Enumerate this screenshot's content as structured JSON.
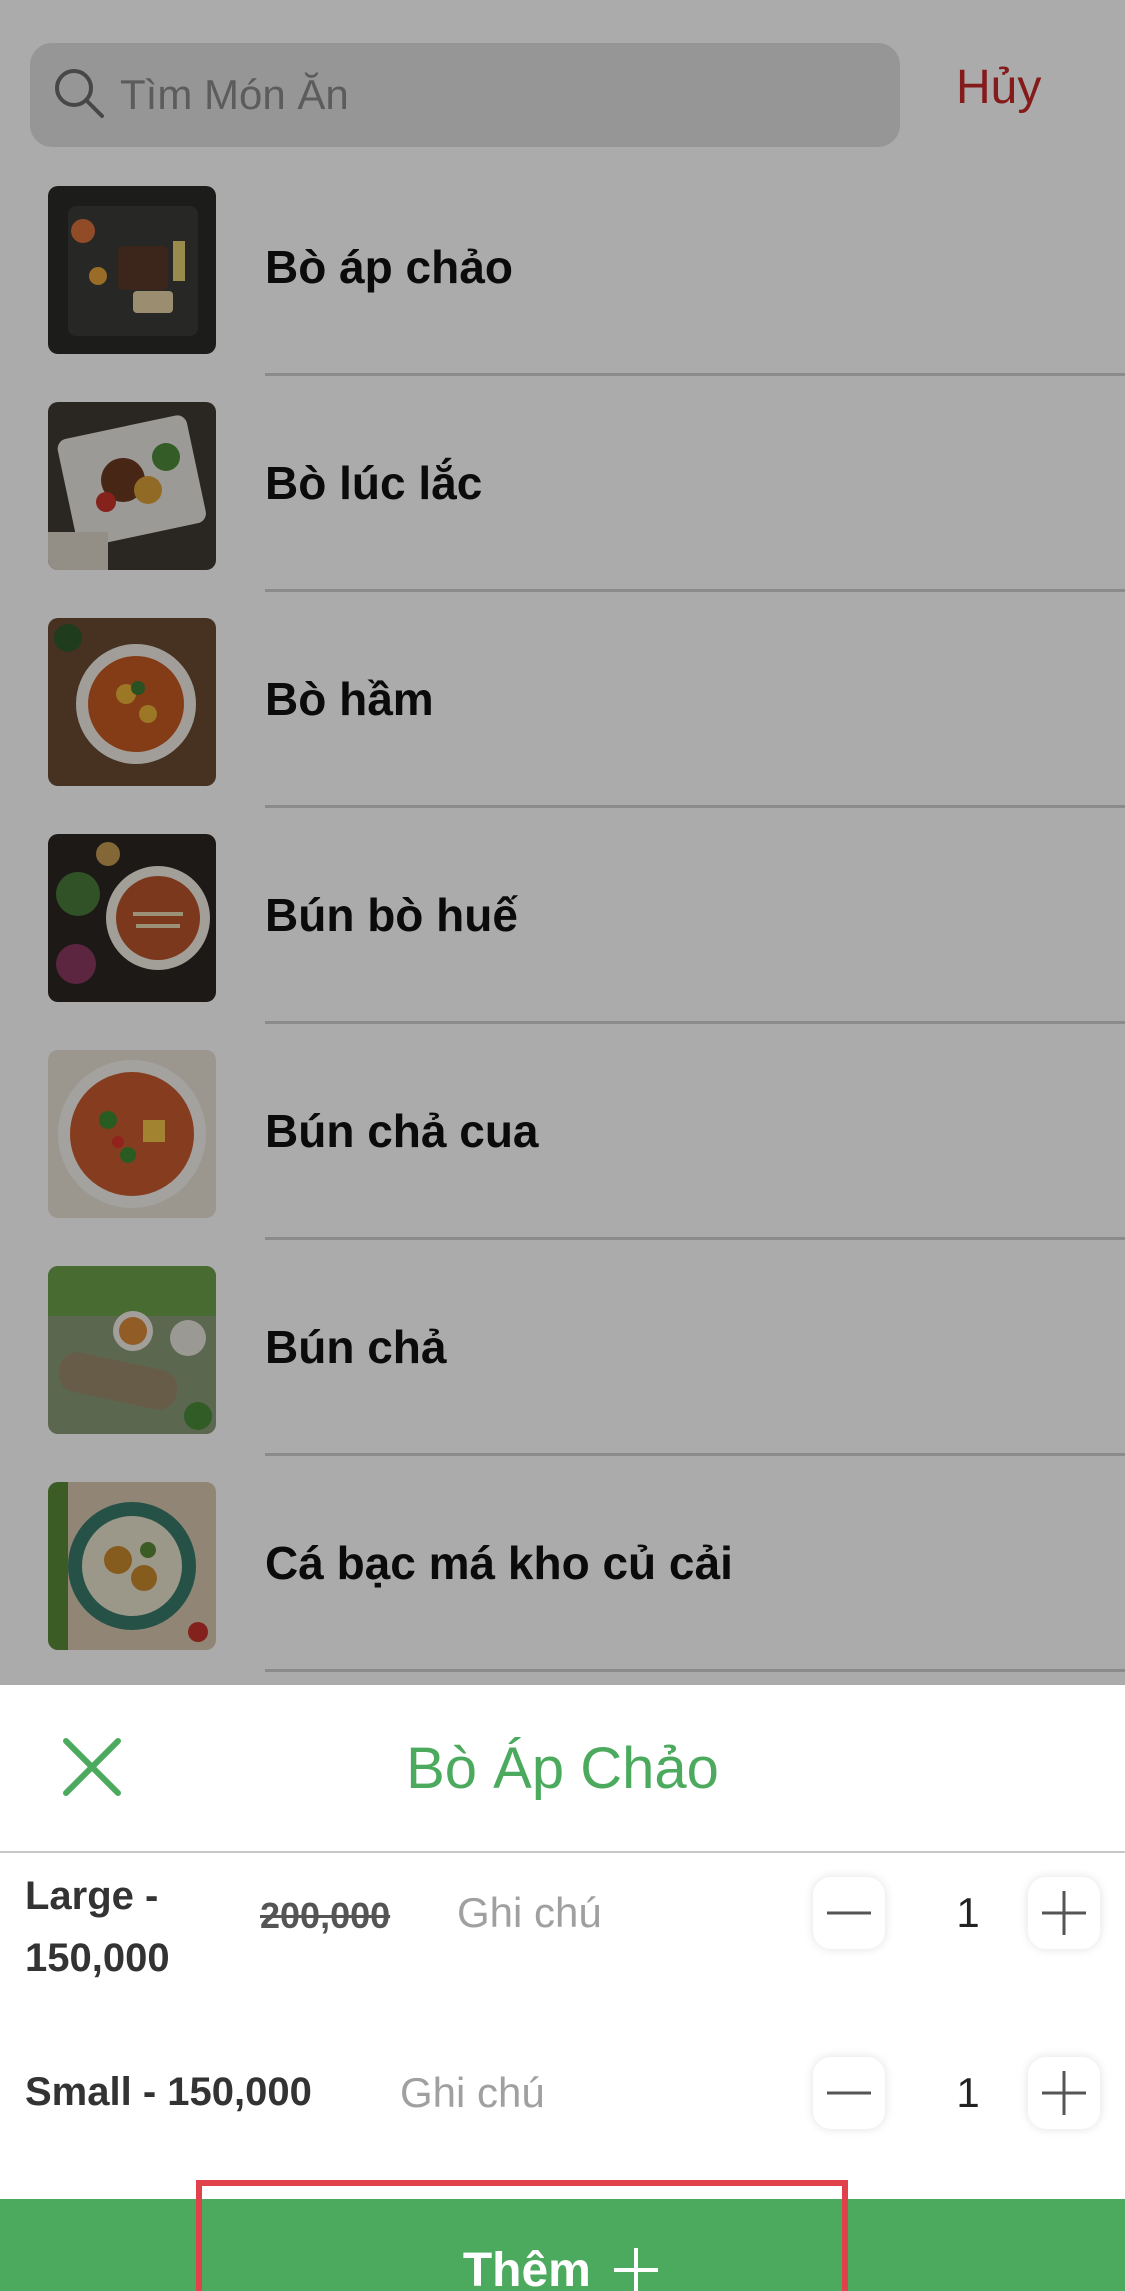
{
  "search": {
    "placeholder": "Tìm Món Ăn",
    "cancel_label": "Hủy"
  },
  "foods": [
    {
      "name": "Bò áp chảo"
    },
    {
      "name": "Bò lúc lắc"
    },
    {
      "name": "Bò hầm"
    },
    {
      "name": "Bún bò huế"
    },
    {
      "name": "Bún chả cua"
    },
    {
      "name": "Bún chả"
    },
    {
      "name": "Cá bạc má kho củ cải"
    }
  ],
  "sheet": {
    "title": "Bò Áp Chảo",
    "variants": [
      {
        "label_line1": "Large -",
        "label_line2": "150,000",
        "old_price": "200,000",
        "note_placeholder": "Ghi chú",
        "quantity": "1"
      },
      {
        "label": "Small - 150,000",
        "note_placeholder": "Ghi chú",
        "quantity": "1"
      }
    ],
    "add_label": "Thêm"
  },
  "colors": {
    "accent": "#4caa5e",
    "cancel": "#c62828",
    "highlight": "#e0414b"
  },
  "icons": [
    "search-icon",
    "close-icon",
    "minus-icon",
    "plus-icon"
  ]
}
